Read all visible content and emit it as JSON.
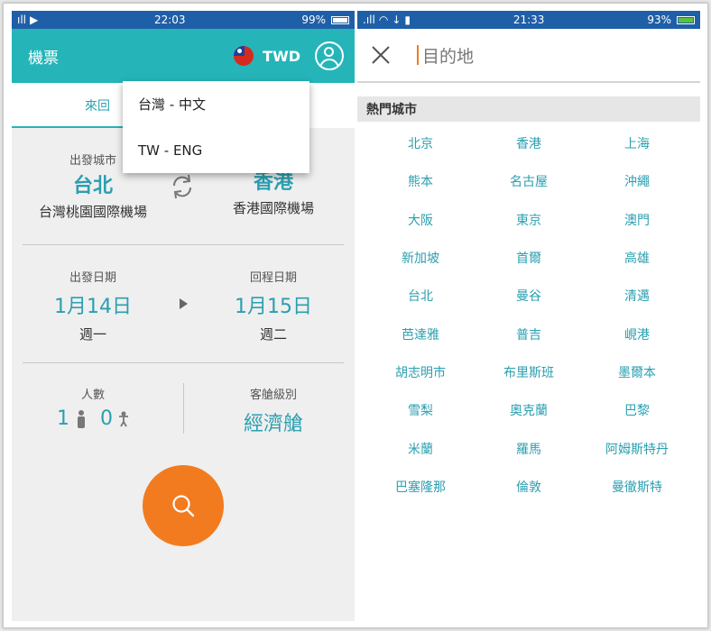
{
  "left_screen": {
    "status_bar": {
      "time": "22:03",
      "battery": "99%"
    },
    "app_bar": {
      "title": "機票",
      "currency": "TWD",
      "flag_icon": "taiwan-flag-icon",
      "profile_icon": "profile-icon"
    },
    "tabs": {
      "active_label": "來回"
    },
    "language_menu": {
      "items": [
        "台灣 - 中文",
        "TW - ENG"
      ]
    },
    "route": {
      "departure_label": "出發城市",
      "origin_city": "台北",
      "origin_airport": "台灣桃園國際機場",
      "destination_city": "香港",
      "destination_airport": "香港國際機場",
      "swap_icon": "swap-icon"
    },
    "dates": {
      "depart_label": "出發日期",
      "depart_date": "1月14日",
      "depart_weekday": "週一",
      "return_label": "回程日期",
      "return_date": "1月15日",
      "return_weekday": "週二"
    },
    "passengers": {
      "label": "人數",
      "adults": "1",
      "children": "0",
      "cabin_label": "客艙級別",
      "cabin_value": "經濟艙"
    },
    "search_icon": "search-icon"
  },
  "right_screen": {
    "status_bar": {
      "time": "21:33",
      "battery": "93%"
    },
    "search": {
      "placeholder": "目的地",
      "close_icon": "close-icon"
    },
    "hot_cities_header": "熱門城市",
    "cities": [
      "北京",
      "香港",
      "上海",
      "熊本",
      "名古屋",
      "沖繩",
      "大阪",
      "東京",
      "澳門",
      "新加坡",
      "首爾",
      "高雄",
      "台北",
      "曼谷",
      "清邁",
      "芭達雅",
      "普吉",
      "峴港",
      "胡志明市",
      "布里斯班",
      "墨爾本",
      "雪梨",
      "奧克蘭",
      "巴黎",
      "米蘭",
      "羅馬",
      "阿姆斯特丹",
      "巴塞隆那",
      "倫敦",
      "曼徹斯特"
    ]
  }
}
